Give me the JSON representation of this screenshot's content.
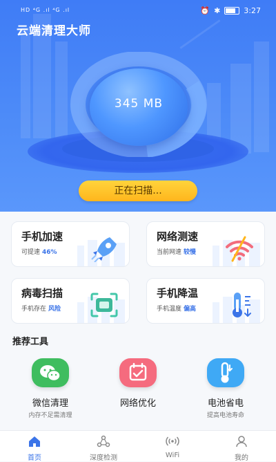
{
  "status_bar": {
    "left_text": "HD ⁴G .ıl ⁴G .ıl",
    "time": "3:27"
  },
  "app_title": "云端清理大师",
  "storage": {
    "size": "345 MB"
  },
  "scan_button_label": "正在扫描...",
  "feature_cards": [
    {
      "title": "手机加速",
      "sub_text": "可提速",
      "highlight": "46%",
      "icon": "rocket-icon"
    },
    {
      "title": "网络测速",
      "sub_text": "当前网速",
      "highlight": "较慢",
      "icon": "wifi-icon"
    },
    {
      "title": "病毒扫描",
      "sub_text": "手机存在",
      "highlight": "风险",
      "icon": "scan-icon"
    },
    {
      "title": "手机降温",
      "sub_text": "手机温度",
      "highlight": "偏高",
      "icon": "thermometer-icon"
    }
  ],
  "tools_section_title": "推荐工具",
  "tools": [
    {
      "label": "微信清理",
      "sub": "内存不足需清理",
      "icon": "wechat-icon",
      "color": "#3fbd5f"
    },
    {
      "label": "网络优化",
      "sub": "",
      "icon": "calendar-check-icon",
      "color": "#f56b7e"
    },
    {
      "label": "电池省电",
      "sub": "提高电池寿命",
      "icon": "thermometer-icon",
      "color": "#3fa9f5"
    }
  ],
  "tabbar": [
    {
      "label": "首页",
      "icon": "home-icon",
      "active": true
    },
    {
      "label": "深度检测",
      "icon": "detect-icon",
      "active": false
    },
    {
      "label": "WiFi",
      "icon": "wifi-signal-icon",
      "active": false
    },
    {
      "label": "我的",
      "icon": "profile-icon",
      "active": false
    }
  ],
  "colors": {
    "primary": "#4a86f7",
    "accent": "#3b74e8",
    "button": "#ffc12a"
  }
}
